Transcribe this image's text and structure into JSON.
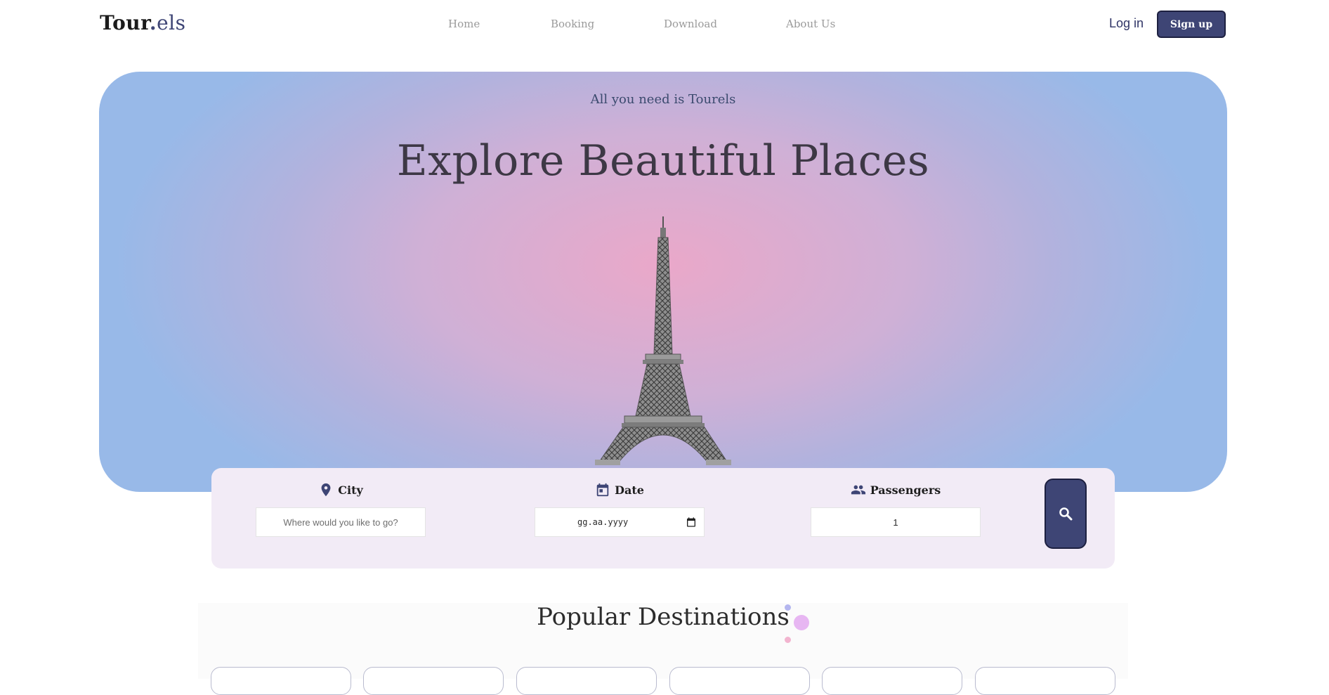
{
  "header": {
    "logo": {
      "part1": "Tour",
      "dot": ".",
      "part2": "els"
    },
    "nav": [
      "Home",
      "Booking",
      "Download",
      "About Us"
    ],
    "login_label": "Log in",
    "signup_label": "Sign up"
  },
  "hero": {
    "tagline": "All you need is Tourels",
    "title": "Explore Beautiful Places"
  },
  "search": {
    "city": {
      "label": "City",
      "placeholder": "Where would you like to go?",
      "icon": "location-pin-icon"
    },
    "date": {
      "label": "Date",
      "value": "gg.aa.yyyy",
      "icon": "calendar-icon"
    },
    "passengers": {
      "label": "Passengers",
      "value": "1",
      "icon": "people-icon"
    },
    "button_icon": "search-icon"
  },
  "popular": {
    "title": "Popular Destinations"
  },
  "colors": {
    "brand": "#3e4575",
    "hero_center": "#eaa8c9",
    "hero_edge": "#98b9e8",
    "search_card_bg": "#f2ebf6"
  }
}
